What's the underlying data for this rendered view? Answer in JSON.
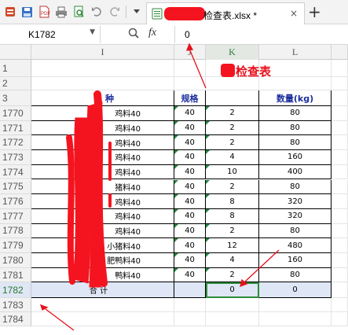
{
  "toolbar": {
    "file_name_tail": "检查表.xlsx *",
    "close_symbol": "×",
    "new_tab_symbol": "+",
    "icons": [
      "app-icon",
      "save-icon",
      "pdf-icon",
      "print-icon",
      "print-preview-icon",
      "undo-icon",
      "redo-icon",
      "more-dropdown-icon",
      "excel-file-icon"
    ]
  },
  "formula_bar": {
    "cell_ref": "K1782",
    "fx_label": "fx",
    "value": "0"
  },
  "columns": [
    "I",
    "J",
    "K",
    "L"
  ],
  "row_numbers": [
    "1",
    "2",
    "3",
    "1770",
    "1771",
    "1772",
    "1773",
    "1774",
    "1775",
    "1776",
    "1777",
    "1778",
    "1779",
    "1780",
    "1781",
    "1782",
    "1783",
    "1784"
  ],
  "sheet_title": "检查表",
  "header_row": {
    "name": "种",
    "spec": "规格",
    "k": "",
    "weight": "数量(kg)"
  },
  "data_rows": [
    {
      "name": "鸡料40",
      "spec": "40",
      "k": "2",
      "weight": "80"
    },
    {
      "name": "鸡料40",
      "spec": "40",
      "k": "2",
      "weight": "80"
    },
    {
      "name": "鸡料40",
      "spec": "40",
      "k": "2",
      "weight": "80"
    },
    {
      "name": "鸡料40",
      "spec": "40",
      "k": "4",
      "weight": "160"
    },
    {
      "name": "鸡料40",
      "spec": "40",
      "k": "10",
      "weight": "400"
    },
    {
      "name": "猪料40",
      "spec": "40",
      "k": "2",
      "weight": "80"
    },
    {
      "name": "鸡料40",
      "spec": "40",
      "k": "8",
      "weight": "320"
    },
    {
      "name": "鸡料40",
      "spec": "40",
      "k": "8",
      "weight": "320"
    },
    {
      "name": "鸡料40",
      "spec": "40",
      "k": "2",
      "weight": "80"
    },
    {
      "name": "小猪料40",
      "spec": "40",
      "k": "12",
      "weight": "480"
    },
    {
      "name": "肥鸭料40",
      "spec": "40",
      "k": "4",
      "weight": "160"
    },
    {
      "name": "鸭料40",
      "spec": "40",
      "k": "2",
      "weight": "80"
    }
  ],
  "total_row": {
    "label": "合    计",
    "k": "0",
    "weight": "0"
  },
  "colors": {
    "redaction": "#f4141f",
    "header_text": "#1c2e9c",
    "selection": "#2e8b3a",
    "selected_row_bg": "#dfe6f5"
  }
}
